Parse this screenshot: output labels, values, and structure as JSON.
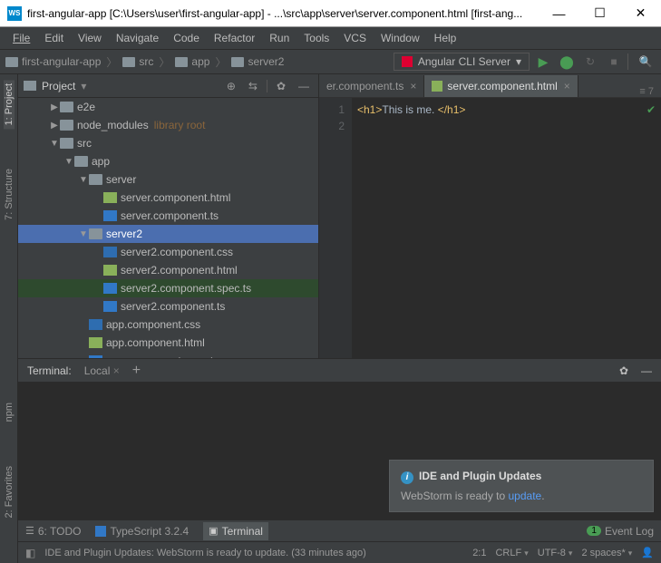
{
  "title": "first-angular-app [C:\\Users\\user\\first-angular-app] - ...\\src\\app\\server\\server.component.html [first-ang...",
  "window": {
    "min": "—",
    "max": "☐",
    "close": "✕"
  },
  "menu": [
    "File",
    "Edit",
    "View",
    "Navigate",
    "Code",
    "Refactor",
    "Run",
    "Tools",
    "VCS",
    "Window",
    "Help"
  ],
  "breadcrumb": [
    "first-angular-app",
    "src",
    "app",
    "server2"
  ],
  "runconfig": "Angular CLI Server",
  "sidebar": {
    "labels": [
      "1: Project",
      "7: Structure",
      "npm",
      "2: Favorites"
    ]
  },
  "project": {
    "title": "Project",
    "nodes": [
      {
        "depth": 1,
        "arrow": "▶",
        "icon": "folder",
        "label": "e2e"
      },
      {
        "depth": 1,
        "arrow": "▶",
        "icon": "folder",
        "label": "node_modules",
        "hint": "library root"
      },
      {
        "depth": 1,
        "arrow": "▼",
        "icon": "folder",
        "label": "src"
      },
      {
        "depth": 2,
        "arrow": "▼",
        "icon": "folder",
        "label": "app"
      },
      {
        "depth": 3,
        "arrow": "▼",
        "icon": "folder",
        "label": "server"
      },
      {
        "depth": 4,
        "arrow": "",
        "icon": "html-i",
        "label": "server.component.html"
      },
      {
        "depth": 4,
        "arrow": "",
        "icon": "ts-i",
        "label": "server.component.ts"
      },
      {
        "depth": 3,
        "arrow": "▼",
        "icon": "folder",
        "label": "server2",
        "sel": "focus"
      },
      {
        "depth": 4,
        "arrow": "",
        "icon": "css-i",
        "label": "server2.component.css"
      },
      {
        "depth": 4,
        "arrow": "",
        "icon": "html-i",
        "label": "server2.component.html"
      },
      {
        "depth": 4,
        "arrow": "",
        "icon": "ts-i",
        "label": "server2.component.spec.ts",
        "hl": true
      },
      {
        "depth": 4,
        "arrow": "",
        "icon": "ts-i",
        "label": "server2.component.ts"
      },
      {
        "depth": 3,
        "arrow": "",
        "icon": "css-i",
        "label": "app.component.css"
      },
      {
        "depth": 3,
        "arrow": "",
        "icon": "html-i",
        "label": "app.component.html"
      },
      {
        "depth": 3,
        "arrow": "",
        "icon": "ts-i",
        "label": "app.component.spec.ts"
      }
    ]
  },
  "tabs": [
    {
      "label": "er.component.ts",
      "icon": "ts-i",
      "active": false,
      "truncated": true
    },
    {
      "label": "server.component.html",
      "icon": "html-i",
      "active": true
    }
  ],
  "tab_indicator": "≡ 7",
  "code": {
    "lines": [
      "1",
      "2"
    ],
    "l1_open": "<h1>",
    "l1_text": "This is me. ",
    "l1_close": "</h1>"
  },
  "terminal": {
    "title": "Terminal:",
    "tab": "Local",
    "notif_title": "IDE and Plugin Updates",
    "notif_body": "WebStorm is ready to ",
    "notif_link": "update"
  },
  "bottom": {
    "todo": "6: TODO",
    "ts": "TypeScript 3.2.4",
    "term": "Terminal",
    "event": "Event Log",
    "badge": "1"
  },
  "status": {
    "msg": "IDE and Plugin Updates: WebStorm is ready to update. (33 minutes ago)",
    "pos": "2:1",
    "crlf": "CRLF",
    "enc": "UTF-8",
    "indent": "2 spaces*"
  }
}
